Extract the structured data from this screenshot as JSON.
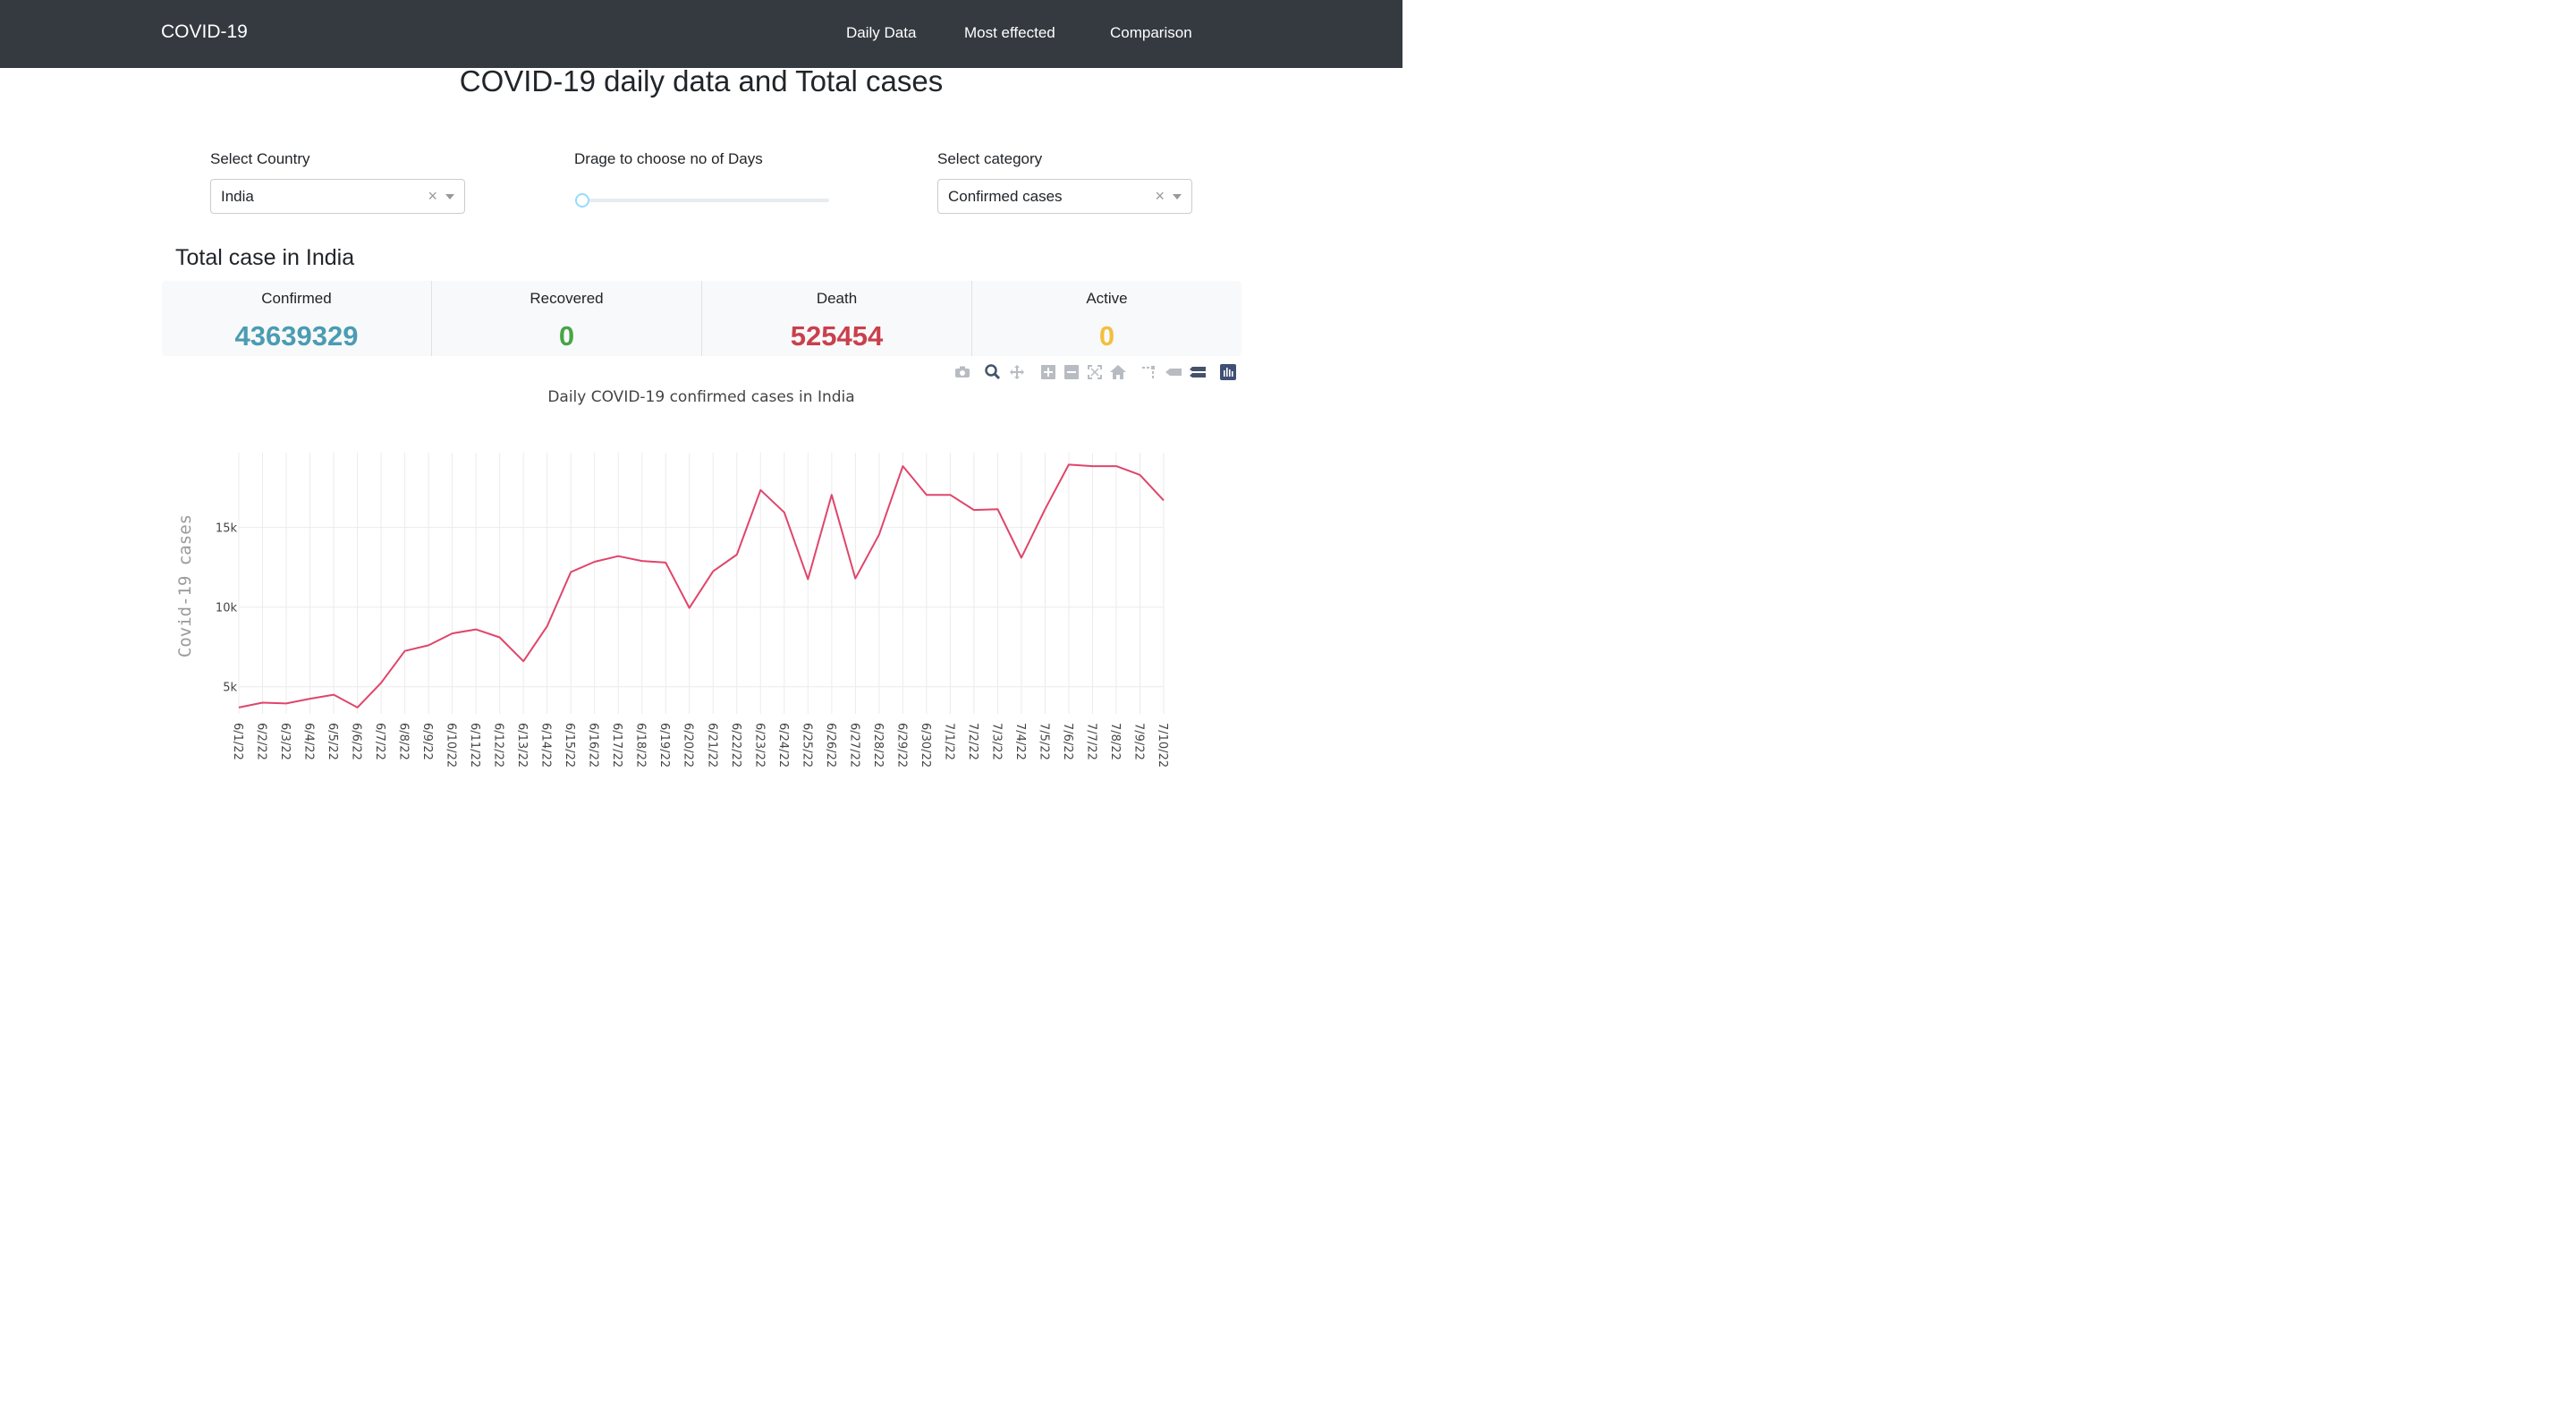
{
  "nav": {
    "brand": "COVID-19",
    "links": [
      "Daily Data",
      "Most effected",
      "Comparison"
    ]
  },
  "page": {
    "title": "COVID-19 daily data and Total cases"
  },
  "controls": {
    "country_label": "Select Country",
    "country_value": "India",
    "days_label": "Drage to choose no of Days",
    "category_label": "Select category",
    "category_value": "Confirmed cases",
    "clear_symbol": "×"
  },
  "totals": {
    "title": "Total case in India",
    "cards": [
      {
        "label": "Confirmed",
        "value": "43639329",
        "color": "#4a9cb3"
      },
      {
        "label": "Recovered",
        "value": "0",
        "color": "#47a447"
      },
      {
        "label": "Death",
        "value": "525454",
        "color": "#c9404d"
      },
      {
        "label": "Active",
        "value": "0",
        "color": "#f2bf3d"
      }
    ]
  },
  "modebar": {
    "icons": [
      "camera-icon",
      "zoom-icon",
      "pan-icon",
      "zoom-in-icon",
      "zoom-out-icon",
      "autoscale-icon",
      "reset-axes-icon",
      "spike-lines-icon",
      "hover-closest-icon",
      "hover-compare-icon",
      "plotly-logo-icon"
    ]
  },
  "chart_data": {
    "type": "line",
    "title": "Daily COVID-19 confirmed cases  in India",
    "ylabel": "Covid-19 cases",
    "xlabel": "",
    "ylim": [
      3300,
      19700
    ],
    "yticks": [
      5000,
      10000,
      15000
    ],
    "ytick_labels": [
      "5k",
      "10k",
      "15k"
    ],
    "line_color": "#e0456b",
    "grid": true,
    "categories": [
      "6/1/22",
      "6/2/22",
      "6/3/22",
      "6/4/22",
      "6/5/22",
      "6/6/22",
      "6/7/22",
      "6/8/22",
      "6/9/22",
      "6/10/22",
      "6/11/22",
      "6/12/22",
      "6/13/22",
      "6/14/22",
      "6/15/22",
      "6/16/22",
      "6/17/22",
      "6/18/22",
      "6/19/22",
      "6/20/22",
      "6/21/22",
      "6/22/22",
      "6/23/22",
      "6/24/22",
      "6/25/22",
      "6/26/22",
      "6/27/22",
      "6/28/22",
      "6/29/22",
      "6/30/22",
      "7/1/22",
      "7/2/22",
      "7/3/22",
      "7/4/22",
      "7/5/22",
      "7/6/22",
      "7/7/22",
      "7/8/22",
      "7/9/22",
      "7/10/22"
    ],
    "values": [
      3700,
      4000,
      3950,
      4250,
      4500,
      3700,
      5250,
      7250,
      7600,
      8350,
      8600,
      8100,
      6600,
      8800,
      12200,
      12850,
      13200,
      12900,
      12800,
      9950,
      12250,
      13300,
      17350,
      15950,
      11750,
      17050,
      11800,
      14550,
      18850,
      17050,
      17050,
      16100,
      16150,
      13100,
      16150,
      18950,
      18850,
      18850,
      18300,
      16700
    ]
  }
}
